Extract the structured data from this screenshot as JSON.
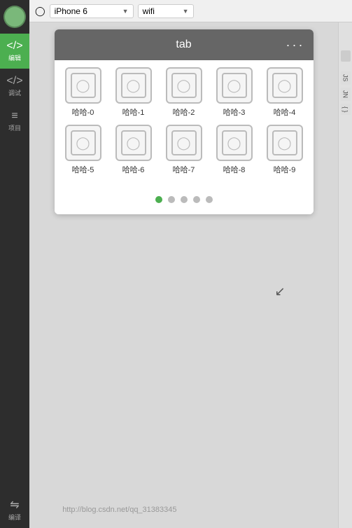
{
  "topbar": {
    "device_name": "iPhone 6",
    "wifi_label": "wifi",
    "phone_icon": "📱"
  },
  "sidebar": {
    "items": [
      {
        "icon": "◉",
        "label": "编辑",
        "active": true
      },
      {
        "icon": "</>",
        "label": "调试",
        "active": false
      },
      {
        "icon": "≡",
        "label": "项目",
        "active": false
      },
      {
        "icon": "⇄",
        "label": "编译",
        "active": false
      }
    ]
  },
  "simulator": {
    "tab_title": "tab",
    "dots_icon": "···",
    "grid_rows": [
      [
        {
          "label": "哈哈-0"
        },
        {
          "label": "哈哈-1"
        },
        {
          "label": "哈哈-2"
        },
        {
          "label": "哈哈-3"
        },
        {
          "label": "哈哈-4"
        }
      ],
      [
        {
          "label": "哈哈-5"
        },
        {
          "label": "哈哈-6"
        },
        {
          "label": "哈哈-7"
        },
        {
          "label": "哈哈-8"
        },
        {
          "label": "哈哈-9"
        }
      ]
    ],
    "pagination": [
      {
        "active": true
      },
      {
        "active": false
      },
      {
        "active": false
      },
      {
        "active": false
      },
      {
        "active": false
      }
    ]
  },
  "right_panel": {
    "labels": [
      "JS",
      "JN",
      "{ }"
    ]
  },
  "watermark": "http://blog.csdn.net/qq_31383345"
}
